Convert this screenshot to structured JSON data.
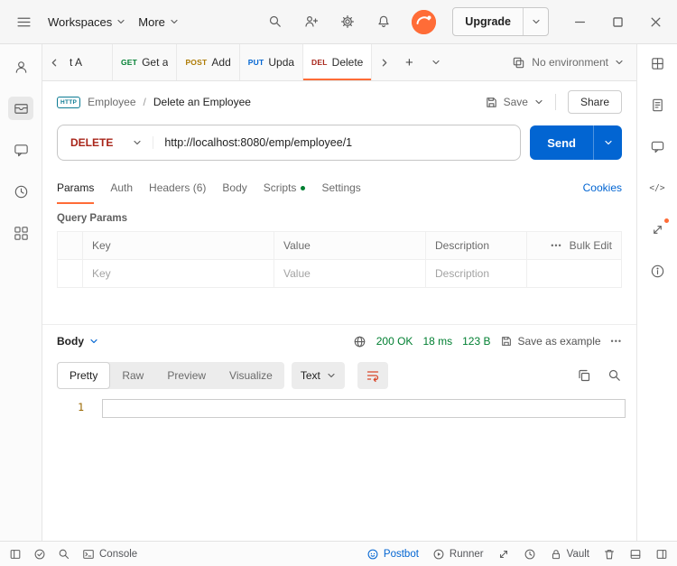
{
  "colors": {
    "accent_orange": "#ff6c37",
    "primary_blue": "#0265d2",
    "success_green": "#007f31",
    "method_delete_red": "#a8251a",
    "method_post_yellow": "#ad7a03"
  },
  "icons": {
    "plus": "+",
    "ellipsis": "•••",
    "code": "</>"
  },
  "topbar": {
    "workspaces": "Workspaces",
    "more": "More",
    "upgrade": "Upgrade"
  },
  "tabbar": {
    "tabs": [
      {
        "method": "",
        "label": "t A"
      },
      {
        "method": "GET",
        "label": "Get a"
      },
      {
        "method": "POST",
        "label": "Add"
      },
      {
        "method": "PUT",
        "label": "Upda"
      },
      {
        "method": "DEL",
        "label": "Delete"
      }
    ],
    "environment": "No environment"
  },
  "request": {
    "breadcrumb": {
      "badge": "HTTP",
      "collection": "Employee",
      "separator": "/",
      "name": "Delete an Employee"
    },
    "save": "Save",
    "share": "Share",
    "method": "DELETE",
    "url": "http://localhost:8080/emp/employee/1",
    "send": "Send",
    "tabs": {
      "params": "Params",
      "auth": "Auth",
      "headers": "Headers (6)",
      "body": "Body",
      "scripts": "Scripts",
      "settings": "Settings"
    },
    "cookies": "Cookies",
    "query_params": {
      "title": "Query Params",
      "columns": {
        "key": "Key",
        "value": "Value",
        "description": "Description"
      },
      "bulk_edit": "Bulk Edit",
      "placeholders": {
        "key": "Key",
        "value": "Value",
        "description": "Description"
      }
    }
  },
  "response": {
    "body_label": "Body",
    "status": "200 OK",
    "time": "18 ms",
    "size": "123 B",
    "save_as_example": "Save as example",
    "views": {
      "pretty": "Pretty",
      "raw": "Raw",
      "preview": "Preview",
      "visualize": "Visualize"
    },
    "format": "Text",
    "line_number": "1"
  },
  "statusbar": {
    "console": "Console",
    "postbot": "Postbot",
    "runner": "Runner",
    "vault": "Vault"
  }
}
